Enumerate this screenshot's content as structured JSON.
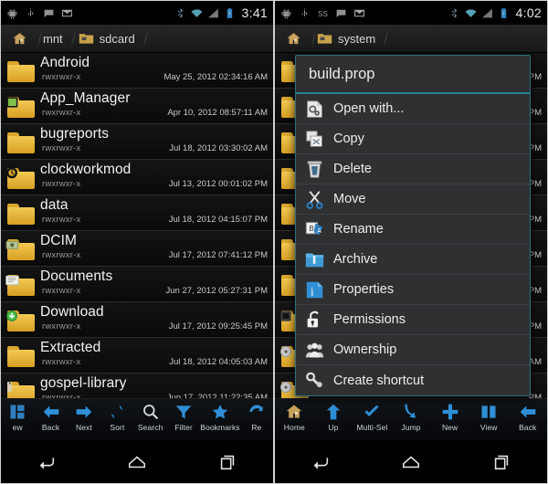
{
  "left": {
    "status_bar": {
      "icons": [
        "android-debug-icon",
        "usb-icon",
        "sms-icon",
        "gmail-icon"
      ],
      "right_icons": [
        "bluetooth-icon",
        "wifi-icon",
        "signal-icon",
        "battery-icon"
      ],
      "clock": "3:41"
    },
    "breadcrumb": {
      "home_icon": "home-icon",
      "items": [
        {
          "label": "mnt",
          "icon": null
        },
        {
          "label": "sdcard",
          "icon": "sdcard-folder-icon"
        }
      ]
    },
    "files": [
      {
        "name": "Android",
        "perm": "rwxrwxr-x",
        "date": "May 25, 2012 02:34:16 AM",
        "badge": "none"
      },
      {
        "name": "App_Manager",
        "perm": "rwxrwxr-x",
        "date": "Apr 10, 2012 08:57:11 AM",
        "badge": "apk"
      },
      {
        "name": "bugreports",
        "perm": "rwxrwxr-x",
        "date": "Jul 18, 2012 03:30:02 AM",
        "badge": "none"
      },
      {
        "name": "clockworkmod",
        "perm": "rwxrwxr-x",
        "date": "Jul 13, 2012 00:01:02 PM",
        "badge": "clock"
      },
      {
        "name": "data",
        "perm": "rwxrwxr-x",
        "date": "Jul 18, 2012 04:15:07 PM",
        "badge": "none"
      },
      {
        "name": "DCIM",
        "perm": "rwxrwxr-x",
        "date": "Jul 17, 2012 07:41:12 PM",
        "badge": "camera"
      },
      {
        "name": "Documents",
        "perm": "rwxrwxr-x",
        "date": "Jun 27, 2012 05:27:31 PM",
        "badge": "doc"
      },
      {
        "name": "Download",
        "perm": "rwxrwxr-x",
        "date": "Jul 17, 2012 09:25:45 PM",
        "badge": "download"
      },
      {
        "name": "Extracted",
        "perm": "rwxrwxr-x",
        "date": "Jul 18, 2012 04:05:03 AM",
        "badge": "none"
      },
      {
        "name": "gospel-library",
        "perm": "rwxrwxr-x",
        "date": "Jun 17, 2012 11:22:35 AM",
        "badge": "book"
      }
    ],
    "toolbar": [
      {
        "label": "ew",
        "icon": "view-icon"
      },
      {
        "label": "Back",
        "icon": "arrow-left-icon"
      },
      {
        "label": "Next",
        "icon": "arrow-right-icon"
      },
      {
        "label": "Sort",
        "icon": "sort-icon"
      },
      {
        "label": "Search",
        "icon": "magnifier-icon"
      },
      {
        "label": "Filter",
        "icon": "funnel-icon"
      },
      {
        "label": "Bookmarks",
        "icon": "star-icon"
      },
      {
        "label": "Re",
        "icon": "refresh-icon"
      }
    ],
    "scroll_percent": 52
  },
  "right": {
    "status_bar": {
      "icons": [
        "android-debug-icon",
        "usb-icon",
        "ss-icon",
        "sms-icon",
        "gmail-icon"
      ],
      "right_icons": [
        "bluetooth-icon",
        "wifi-icon",
        "signal-icon",
        "battery-icon"
      ],
      "clock": "4:02"
    },
    "breadcrumb": {
      "home_icon": "home-icon",
      "items": [
        {
          "label": "system",
          "icon": "system-folder-icon"
        }
      ]
    },
    "files": [
      {
        "name": "",
        "perm": "",
        "date": "PM",
        "badge": "none"
      },
      {
        "name": "",
        "perm": "",
        "date": "PM",
        "badge": "none"
      },
      {
        "name": "",
        "perm": "",
        "date": "PM",
        "badge": "none"
      },
      {
        "name": "",
        "perm": "",
        "date": "PM",
        "badge": "none"
      },
      {
        "name": "",
        "perm": "",
        "date": "PM",
        "badge": "none"
      },
      {
        "name": "",
        "perm": "",
        "date": "PM",
        "badge": "none"
      },
      {
        "name": "",
        "perm": "",
        "date": "PM",
        "badge": "none"
      },
      {
        "name": "",
        "perm": "",
        "date": "PM",
        "badge": "file"
      },
      {
        "name": "",
        "perm": "",
        "date": "AM",
        "badge": "disc"
      },
      {
        "name": "",
        "perm": "",
        "date": "PM",
        "badge": "disc"
      }
    ],
    "context_menu": {
      "title": "build.prop",
      "items": [
        {
          "label": "Open with...",
          "icon": "open-with-icon"
        },
        {
          "label": "Copy",
          "icon": "copy-icon"
        },
        {
          "label": "Delete",
          "icon": "trash-icon"
        },
        {
          "label": "Move",
          "icon": "scissors-icon"
        },
        {
          "label": "Rename",
          "icon": "rename-icon"
        },
        {
          "label": "Archive",
          "icon": "archive-icon"
        },
        {
          "label": "Properties",
          "icon": "info-icon"
        },
        {
          "label": "Permissions",
          "icon": "lock-open-icon"
        },
        {
          "label": "Ownership",
          "icon": "users-icon"
        },
        {
          "label": "Create shortcut",
          "icon": "shortcut-icon"
        }
      ]
    },
    "toolbar": [
      {
        "label": "Home",
        "icon": "home-icon"
      },
      {
        "label": "Up",
        "icon": "arrow-up-icon"
      },
      {
        "label": "Multi-Sel",
        "icon": "check-icon"
      },
      {
        "label": "Jump",
        "icon": "jump-arrow-icon"
      },
      {
        "label": "New",
        "icon": "plus-icon"
      },
      {
        "label": "View",
        "icon": "columns-icon"
      },
      {
        "label": "Back",
        "icon": "arrow-left-icon"
      }
    ]
  },
  "navbar": {
    "back": "back-nav-icon",
    "home": "home-nav-icon",
    "recents": "recents-nav-icon"
  },
  "colors": {
    "accent_teal": "#2b7f90",
    "accent_blue": "#2d7fc4",
    "folder_yellow": "#e2b03a",
    "menu_bg": "#2e3032",
    "list_bg": "#0b0b0b"
  }
}
